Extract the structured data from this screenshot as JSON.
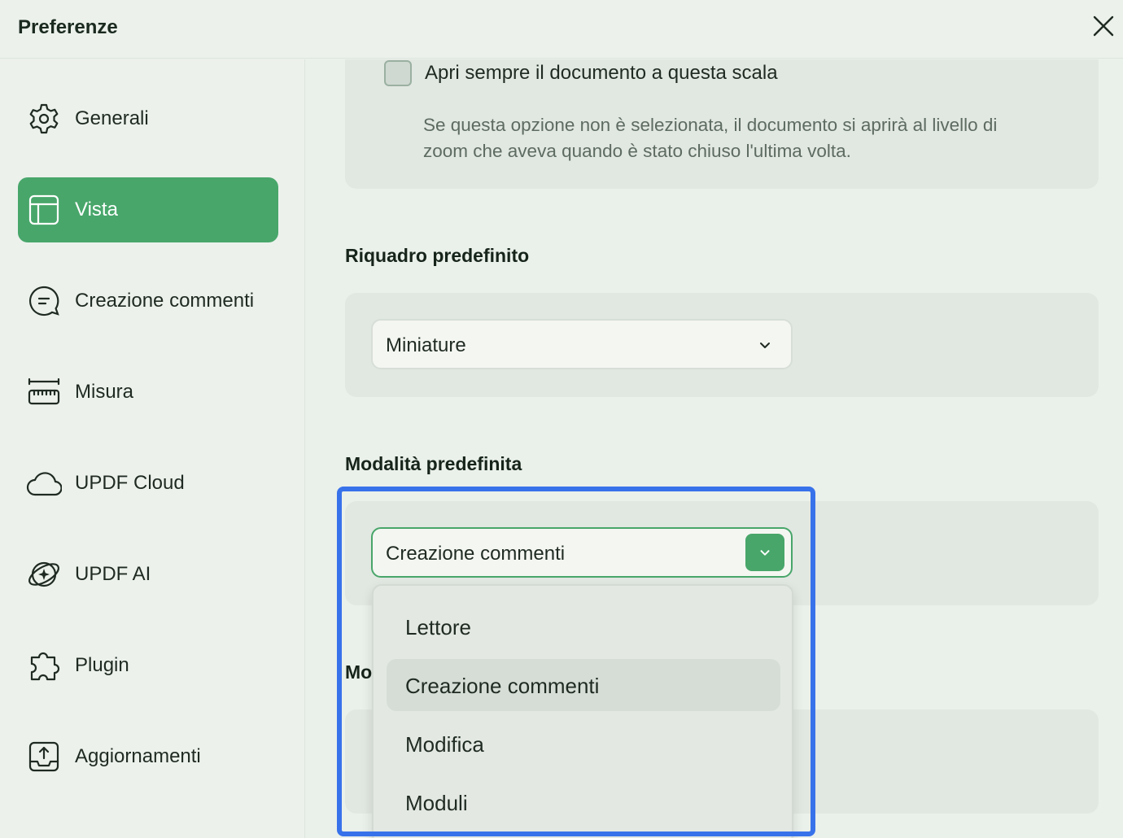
{
  "window": {
    "title": "Preferenze"
  },
  "sidebar": {
    "items": [
      {
        "label": "Generali",
        "icon": "gear-icon"
      },
      {
        "label": "Vista",
        "icon": "layout-icon",
        "active": true
      },
      {
        "label": "Creazione commenti",
        "icon": "comment-icon"
      },
      {
        "label": "Misura",
        "icon": "ruler-icon"
      },
      {
        "label": "UPDF Cloud",
        "icon": "cloud-icon"
      },
      {
        "label": "UPDF AI",
        "icon": "ai-icon"
      },
      {
        "label": "Plugin",
        "icon": "puzzle-icon"
      },
      {
        "label": "Aggiornamenti",
        "icon": "update-icon"
      }
    ]
  },
  "main": {
    "scale_option": {
      "label": "Apri sempre il documento a questa scala",
      "checked": false,
      "help": "Se questa opzione non è selezionata, il documento si aprirà al livello di zoom che aveva quando è stato chiuso l'ultima volta."
    },
    "default_pane": {
      "title": "Riquadro predefinito",
      "value": "Miniature"
    },
    "default_mode": {
      "title": "Modalità predefinita",
      "value": "Creazione commenti",
      "options": [
        "Lettore",
        "Creazione commenti",
        "Modifica",
        "Moduli"
      ],
      "selected_index": 1
    },
    "next_section_title_partial": "Mo"
  },
  "colors": {
    "accent": "#48a66a",
    "highlight": "#3872ea",
    "background": "#eaf0ea",
    "card": "#e1e7e1"
  }
}
